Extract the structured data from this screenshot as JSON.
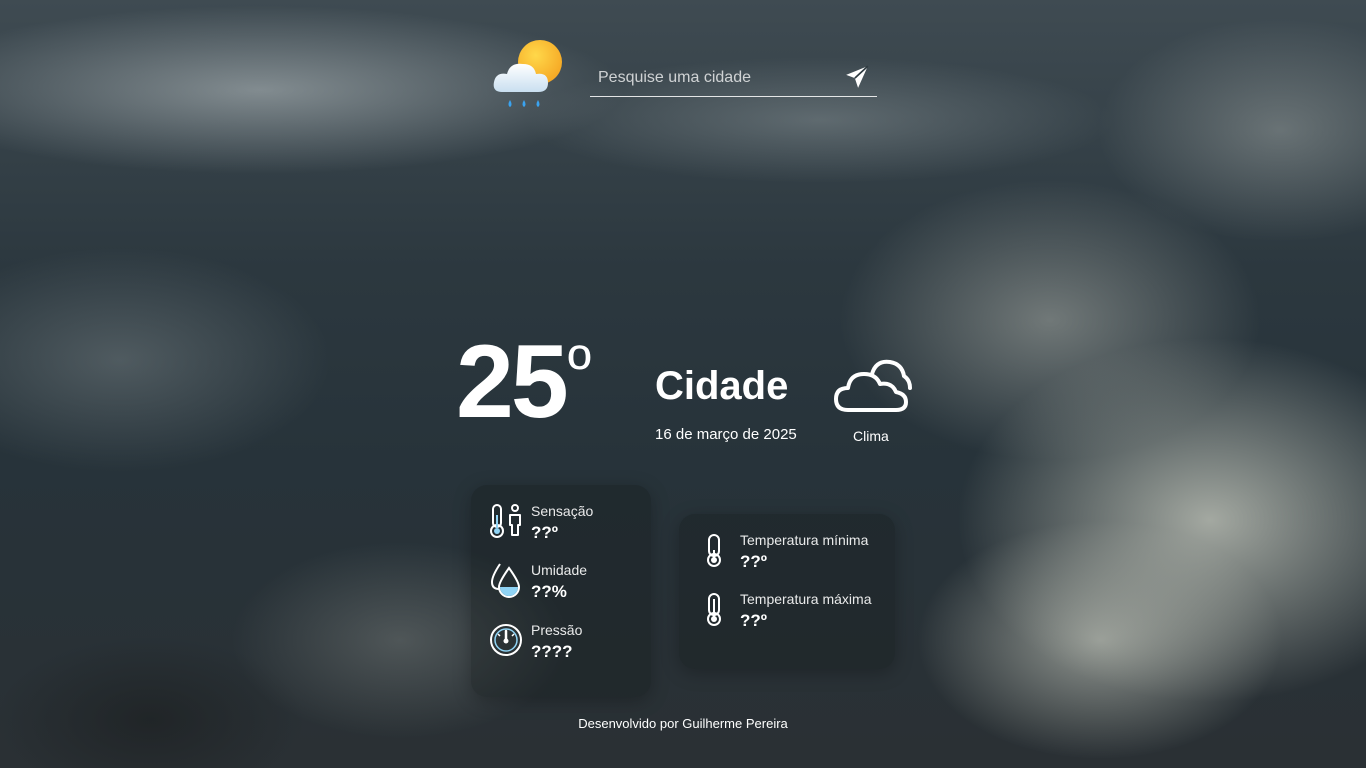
{
  "search": {
    "placeholder": "Pesquise uma cidade"
  },
  "weather": {
    "temperature": "25",
    "degree_symbol": "º",
    "city": "Cidade",
    "date": "16 de março de 2025",
    "condition": "Clima",
    "condition_icon": "cloud-icon"
  },
  "details_left": [
    {
      "label": "Sensação",
      "value": "??º",
      "icon": "feels-like-icon"
    },
    {
      "label": "Umidade",
      "value": "??%",
      "icon": "humidity-icon"
    },
    {
      "label": "Pressão",
      "value": "????",
      "icon": "pressure-icon"
    }
  ],
  "details_right": [
    {
      "label": "Temperatura mínima",
      "value": "??º",
      "icon": "thermometer-low-icon"
    },
    {
      "label": "Temperatura máxima",
      "value": "??º",
      "icon": "thermometer-high-icon"
    }
  ],
  "footer": {
    "text": "Desenvolvido por Guilherme Pereira"
  },
  "colors": {
    "accent_sun": "#f5b62b",
    "accent_rain": "#3aa3f0",
    "icon_highlight": "#8fd3f4"
  }
}
